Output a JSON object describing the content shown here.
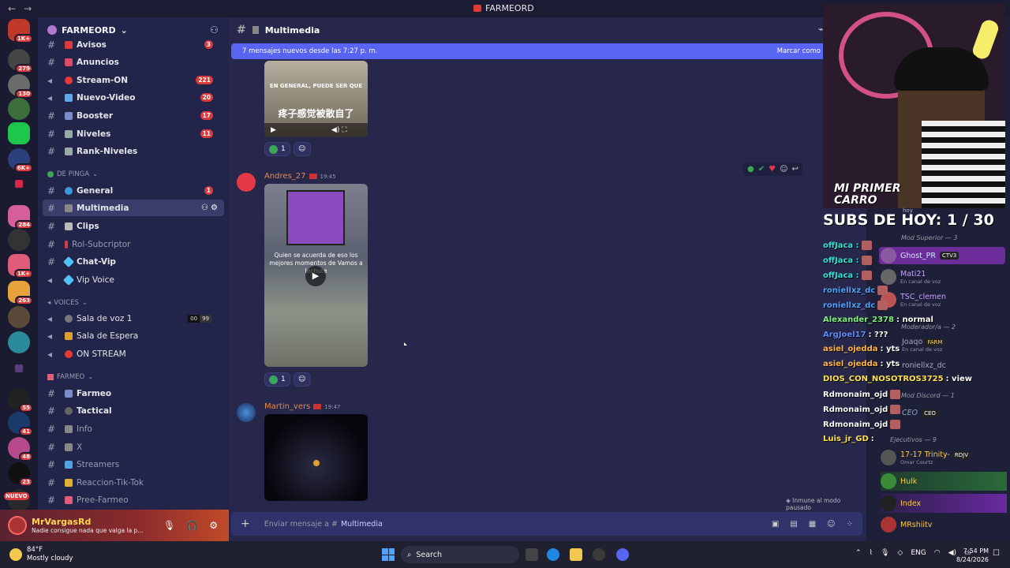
{
  "window": {
    "title": "FARMEORD",
    "back": "←",
    "forward": "→"
  },
  "server": {
    "name": "FARMEORD",
    "badges": [
      "1K+",
      "279",
      "130",
      "6K+",
      "284",
      "1K+",
      "263",
      "55",
      "41",
      "48",
      "23"
    ],
    "new_label": "NUEVO"
  },
  "channels": [
    {
      "name": "Avisos",
      "badge": "3"
    },
    {
      "name": "Anuncios",
      "badge": ""
    },
    {
      "name": "Stream-ON",
      "badge": "221"
    },
    {
      "name": "Nuevo-Video",
      "badge": "20"
    },
    {
      "name": "Booster",
      "badge": "17"
    },
    {
      "name": "Niveles",
      "badge": "11"
    },
    {
      "name": "Rank-Niveles",
      "badge": ""
    }
  ],
  "categories": {
    "de_pinga": "DE PINGA",
    "voices": "VOICES",
    "farmeo": "FARMEO"
  },
  "de_pinga_channels": [
    {
      "name": "General",
      "badge": "1"
    },
    {
      "name": "Multimedia",
      "badge": ""
    },
    {
      "name": "Clips",
      "badge": ""
    },
    {
      "name": "Rol-Subcriptor",
      "badge": ""
    },
    {
      "name": "Chat-Vip",
      "badge": ""
    },
    {
      "name": "Vip Voice",
      "badge": ""
    }
  ],
  "voice_channels": [
    {
      "name": "Sala de voz 1",
      "counts": [
        "00",
        "99"
      ]
    },
    {
      "name": "Sala de Espera"
    },
    {
      "name": "ON STREAM"
    }
  ],
  "farmeo_channels": [
    "Farmeo",
    "Tactical",
    "Info",
    "X",
    "Streamers",
    "Reaccion-Tik-Tok",
    "Pree-Farmeo"
  ],
  "user": {
    "name": "MrVargasRd",
    "status": "Nadie consigue nada que valga la p..."
  },
  "chat": {
    "channel": "Multimedia",
    "new_messages": "7 mensajes nuevos desde las 7:27 p. m.",
    "mark_read": "Marcar como l",
    "video1_caption": "EN GENERAL, PUEDE SER QUE",
    "video1_sub": "疼子感觉被散自了",
    "react_count": "1",
    "messages": [
      {
        "author": "Andres_27",
        "time": "19:45",
        "caption": "Quien se acuerda de eso los mejores momentos de Vamos a lechute"
      },
      {
        "author": "Martin_vers",
        "time": "19:47"
      }
    ],
    "paused": "Inmune al modo pausado",
    "composer_placeholder": "Enviar mensaje a #",
    "composer_channel": "Multimedia"
  },
  "overlay": {
    "subs": "SUBS DE HOY: 1 / 30",
    "carro": [
      "MI PRIMER",
      "CARRO"
    ],
    "chat_lines": [
      {
        "user": "offJaca :",
        "text": "",
        "color": "#2ee6d6"
      },
      {
        "user": "offJaca :",
        "text": "",
        "color": "#2ee6d6"
      },
      {
        "user": "offJaca :",
        "text": "",
        "color": "#2ee6d6"
      },
      {
        "user": "roniellxz_dc",
        "text": "",
        "color": "#4aa3ff"
      },
      {
        "user": "roniellxz_dc",
        "text": "",
        "color": "#4aa3ff"
      },
      {
        "user": "Alexander_2378",
        "text": ": normal",
        "color": "#7ef07e"
      },
      {
        "user": "ArgJoel17",
        "text": ": ???",
        "color": "#5b8cff"
      },
      {
        "user": "asiel_ojedda",
        "text": ": yts",
        "color": "#ffb347"
      },
      {
        "user": "asiel_ojedda",
        "text": ": yts",
        "color": "#ffb347"
      },
      {
        "user": "DIOS_CON_NOSOTROS3725",
        "text": ": view",
        "color": "#ffe14d"
      },
      {
        "user": "Rdmonaim_ojd",
        "text": "",
        "color": "#ffffff"
      },
      {
        "user": "Rdmonaim_ojd",
        "text": "",
        "color": "#ffffff"
      },
      {
        "user": "Rdmonaim_ojd",
        "text": "",
        "color": "#ffffff"
      },
      {
        "user": "Luis_jr_GD",
        "text": ":",
        "color": "#ffe14d"
      }
    ],
    "header_partial": "Mod Superior — 3",
    "hoy": "hoy"
  },
  "members": {
    "mod_cat": "Moderador/a — 2",
    "discord_cat": "Mod Discord — 1",
    "ejec_cat": "Ejecutivos — 9",
    "list": [
      {
        "name": "Ghost_PR",
        "tag": "CTV3",
        "sub": ""
      },
      {
        "name": "Mati21",
        "sub": "En canal de voz"
      },
      {
        "name": "TSC_clemen",
        "sub": "En canal de voz"
      },
      {
        "name": "Joaqo",
        "tag": "FARM",
        "sub": "En canal de voz"
      },
      {
        "name": "roniellxz_dc",
        "sub": ""
      },
      {
        "name": "CEO",
        "tag": "CEO",
        "sub": ""
      },
      {
        "name": "17-17 Trinity-",
        "tag": "RDJV",
        "sub": "Omar Courtz"
      },
      {
        "name": "Hulk",
        "sub": ""
      },
      {
        "name": "Index",
        "sub": ""
      },
      {
        "name": "MRshiitv",
        "sub": ""
      }
    ]
  },
  "taskbar": {
    "temp": "84°F",
    "weather": "Mostly cloudy",
    "search": "Search",
    "lang": "ENG",
    "time": "7:54 PM",
    "date": "8/24/2026"
  }
}
